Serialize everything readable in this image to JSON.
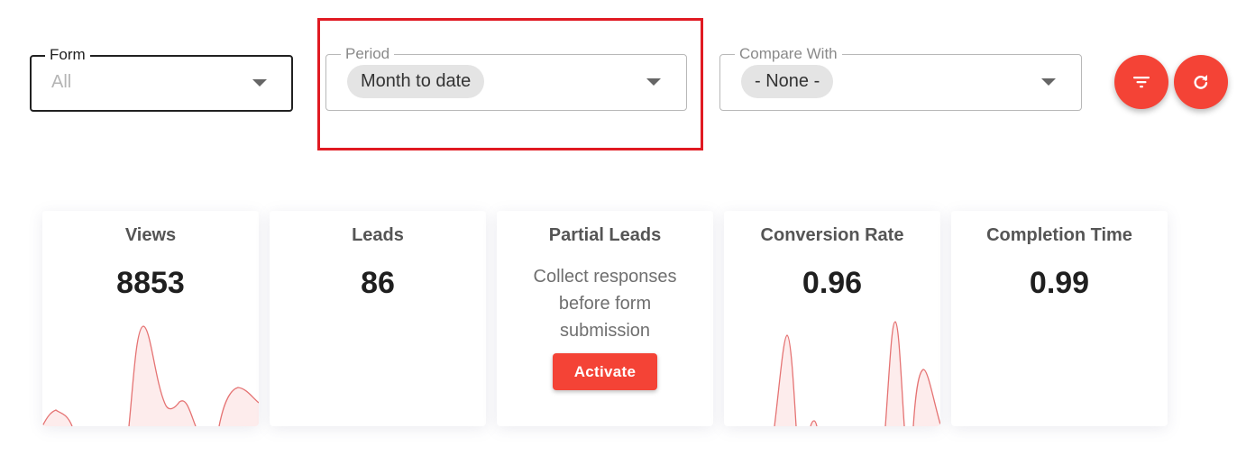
{
  "filters": {
    "form": {
      "label": "Form",
      "value": "All"
    },
    "period": {
      "label": "Period",
      "value": "Month to date"
    },
    "compare": {
      "label": "Compare With",
      "value": "- None -"
    }
  },
  "actions": {
    "filter_icon": "filter-icon",
    "refresh_icon": "refresh-icon"
  },
  "colors": {
    "accent": "#f44336",
    "highlight": "#e01a22",
    "spark_line": "#e57373",
    "spark_fill": "#fdecec"
  },
  "cards": [
    {
      "title": "Views",
      "value": "8853"
    },
    {
      "title": "Leads",
      "value": "86"
    },
    {
      "title": "Partial Leads",
      "description": "Collect responses before form submission",
      "button": "Activate"
    },
    {
      "title": "Conversion Rate",
      "value": "0.96"
    },
    {
      "title": "Completion Time",
      "value": "0.99"
    }
  ]
}
